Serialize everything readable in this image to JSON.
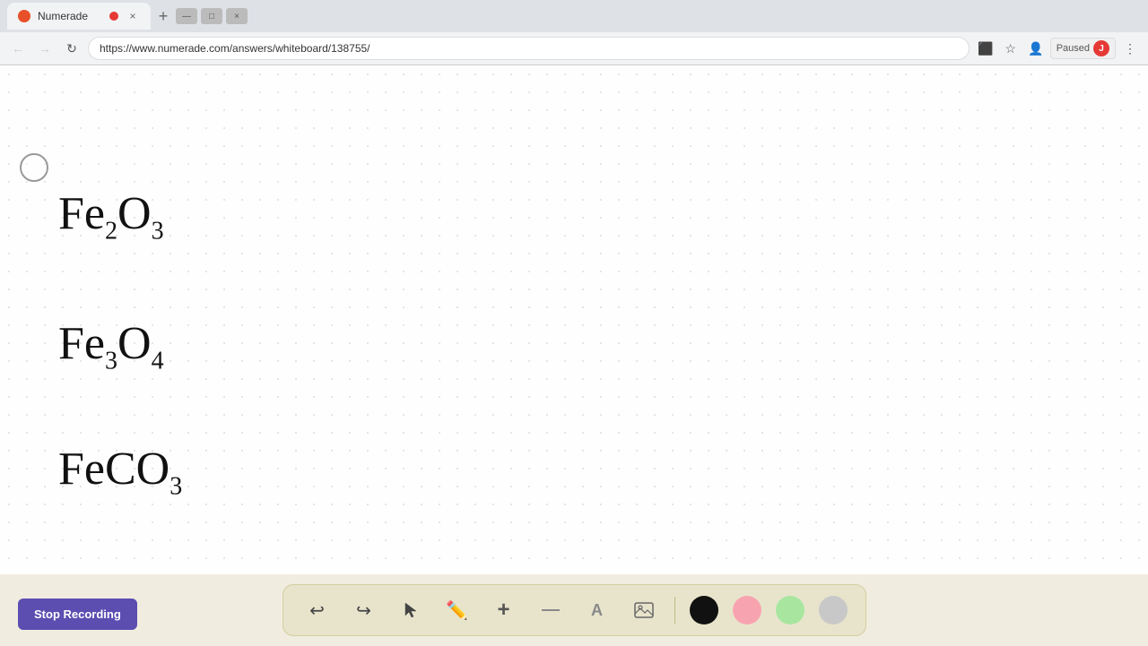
{
  "browser": {
    "tab": {
      "favicon_color": "#e8502a",
      "title": "Numerade",
      "recording_dot": true,
      "close_label": "×"
    },
    "new_tab_label": "+",
    "address": "https://www.numerade.com/answers/whiteboard/138755/",
    "paused_label": "Paused",
    "window_controls": {
      "minimize": "—",
      "maximize": "□",
      "close": "×"
    }
  },
  "whiteboard": {
    "formulas": [
      {
        "id": "fe2o3",
        "text": "Fe₂O₃",
        "display": "Fe<sub>2</sub>O<sub>3</sub>"
      },
      {
        "id": "fe3o4",
        "text": "Fe₃O₄",
        "display": "Fe<sub>3</sub>O<sub>4</sub>"
      },
      {
        "id": "feco3",
        "text": "FeCO₃",
        "display": "FeCO<sub>3</sub>"
      }
    ]
  },
  "toolbar": {
    "stop_recording_label": "Stop Recording",
    "tools": [
      {
        "id": "undo",
        "icon": "↩",
        "label": "undo"
      },
      {
        "id": "redo",
        "icon": "↪",
        "label": "redo"
      },
      {
        "id": "select",
        "icon": "▶",
        "label": "select"
      },
      {
        "id": "pen",
        "icon": "✏",
        "label": "pen"
      },
      {
        "id": "add",
        "icon": "+",
        "label": "add"
      },
      {
        "id": "eraser",
        "icon": "⌫",
        "label": "eraser"
      },
      {
        "id": "text",
        "icon": "A",
        "label": "text"
      },
      {
        "id": "image",
        "icon": "🖼",
        "label": "image"
      }
    ],
    "colors": [
      {
        "id": "black",
        "value": "#111111",
        "class": "color-black"
      },
      {
        "id": "pink",
        "value": "#f8a4b0",
        "class": "color-pink"
      },
      {
        "id": "green",
        "value": "#a8e6a0",
        "class": "color-green"
      },
      {
        "id": "gray",
        "value": "#c8c8c8",
        "class": "color-gray"
      }
    ]
  }
}
